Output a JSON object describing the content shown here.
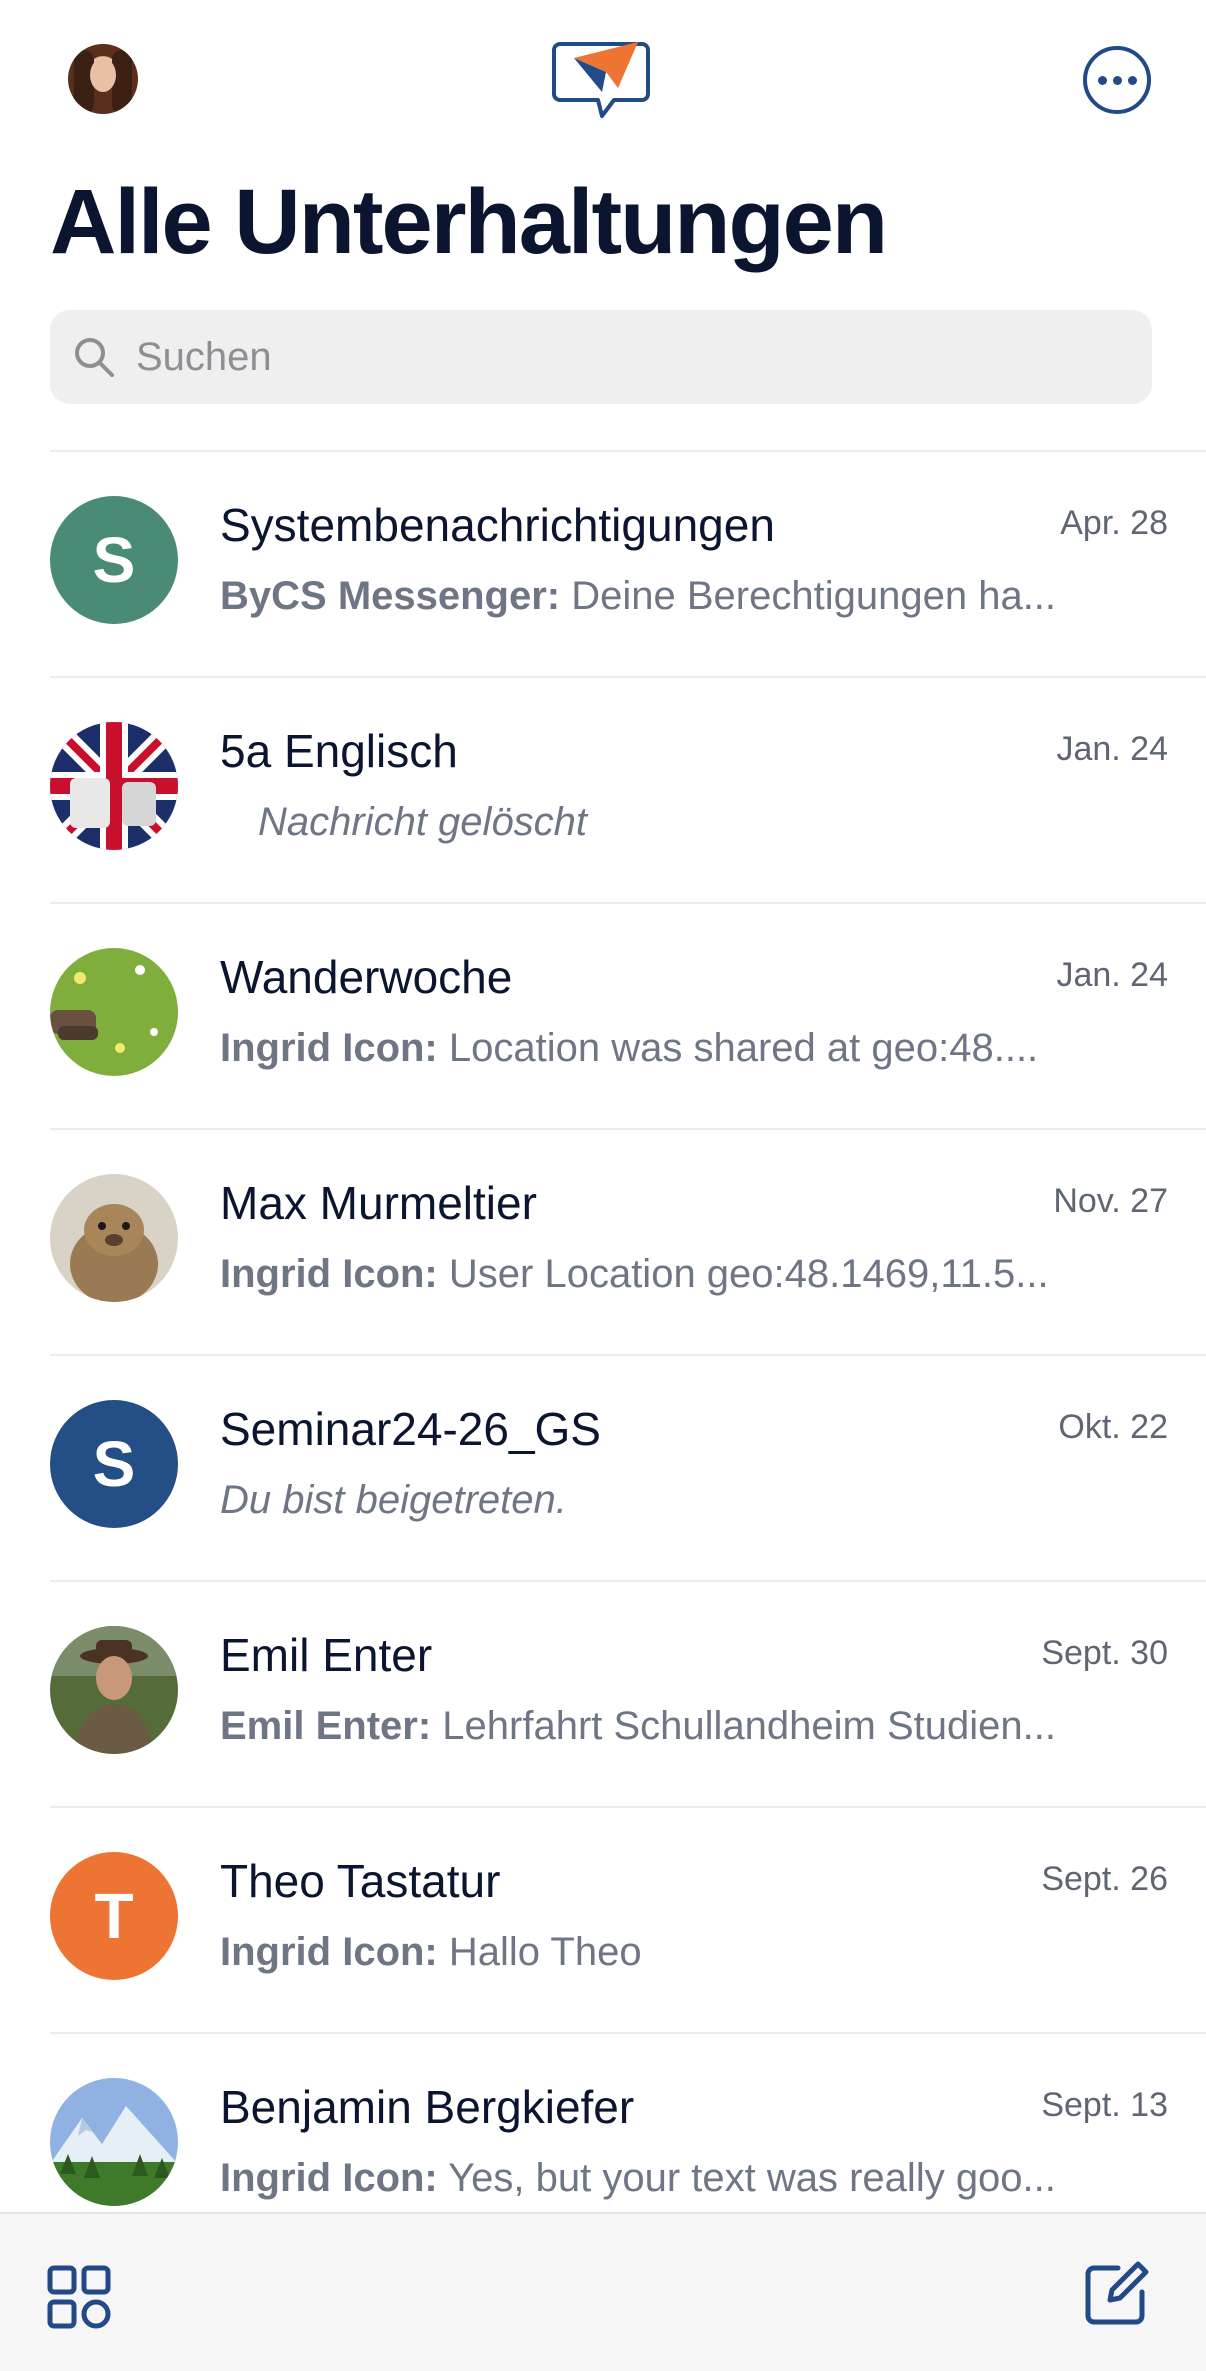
{
  "header": {
    "title": "Alle Unterhaltungen",
    "search_placeholder": "Suchen",
    "accent_color": "#224a86"
  },
  "conversations": [
    {
      "name": "Systembenachrichtigungen",
      "date": "Apr. 28",
      "sender": "ByCS Messenger:",
      "message": "Deine Berechtigungen ha...",
      "avatar_letter": "S",
      "avatar_color": "#4a8b78",
      "avatar_type": "letter"
    },
    {
      "name": "5a Englisch",
      "date": "Jan. 24",
      "sender": "",
      "message": "Nachricht gelöscht",
      "avatar_type": "photo-union-jack"
    },
    {
      "name": "Wanderwoche",
      "date": "Jan. 24",
      "sender": "Ingrid Icon:",
      "message": "Location was shared at geo:48....",
      "avatar_type": "photo-meadow"
    },
    {
      "name": "Max Murmeltier",
      "date": "Nov. 27",
      "sender": "Ingrid Icon:",
      "message": "User Location geo:48.1469,11.5...",
      "avatar_type": "photo-marmot"
    },
    {
      "name": "Seminar24-26_GS",
      "date": "Okt. 22",
      "sender": "",
      "message": "Du bist beigetreten.",
      "avatar_letter": "S",
      "avatar_color": "#234e86",
      "avatar_type": "letter"
    },
    {
      "name": "Emil Enter",
      "date": "Sept. 30",
      "sender": "Emil Enter:",
      "message": "Lehrfahrt Schullandheim Studien...",
      "avatar_type": "photo-man-hat"
    },
    {
      "name": "Theo Tastatur",
      "date": "Sept. 26",
      "sender": "Ingrid Icon:",
      "message": "Hallo Theo",
      "avatar_letter": "T",
      "avatar_color": "#ee7434",
      "avatar_type": "letter"
    },
    {
      "name": "Benjamin Bergkiefer",
      "date": "Sept. 13",
      "sender": "Ingrid Icon:",
      "message": "Yes, but your text was really goo...",
      "avatar_type": "photo-mountains"
    }
  ]
}
